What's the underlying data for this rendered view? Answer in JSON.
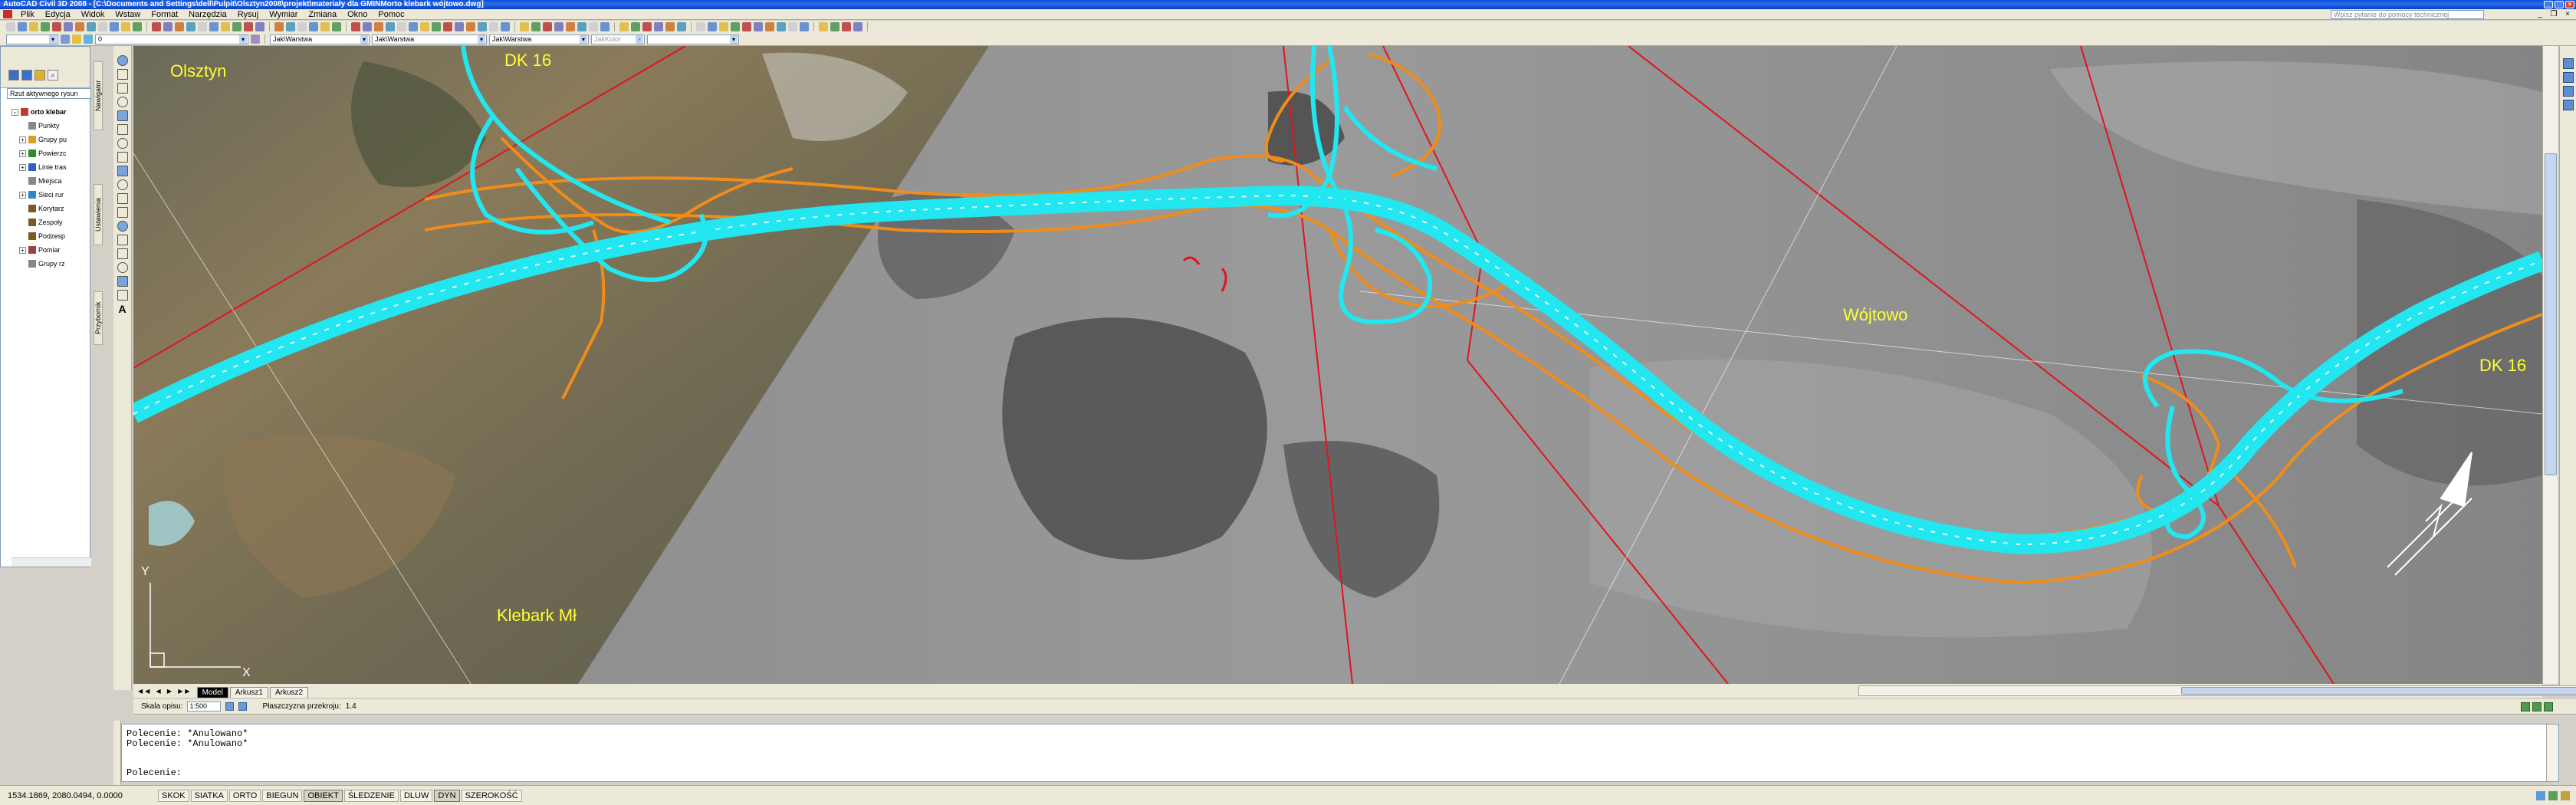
{
  "window": {
    "title": "AutoCAD Civil 3D 2008 - [C:\\Documents and Settings\\dell\\Pulpit\\Olsztyn2008\\projekt\\materiały dla GMINMorto klebark wójtowo.dwg]"
  },
  "menu": {
    "items": [
      "Plik",
      "Edycja",
      "Widok",
      "Wstaw",
      "Format",
      "Narzędzia",
      "Rysuj",
      "Wymiar",
      "Zmiana",
      "Okno",
      "Pomoc"
    ],
    "help_placeholder": "Wpisz pytanie do pomocy technicznej"
  },
  "toolbar": {
    "layer_combo": "Jak\\Warstwa",
    "linetype_combo": "Jak\\Warstwa",
    "lineweight_combo": "Jak\\Warstwa",
    "plotstyle_combo": "JakKolor",
    "layer_name": "0",
    "extra_combo": ""
  },
  "prospector": {
    "view_combo": "Rzut aktywnego rysun",
    "tree": [
      {
        "label": "orto klebar",
        "root": true,
        "expander": "-",
        "color": "#c0392b"
      },
      {
        "label": "Punkty",
        "expander": "",
        "color": "#888888"
      },
      {
        "label": "Grupy pu",
        "expander": "+",
        "color": "#d8a020"
      },
      {
        "label": "Powierzc",
        "expander": "+",
        "color": "#2e8b2e"
      },
      {
        "label": "Linie tras",
        "expander": "+",
        "color": "#3060c0"
      },
      {
        "label": "Miejsca",
        "expander": "",
        "color": "#888888"
      },
      {
        "label": "Sieci rur",
        "expander": "+",
        "color": "#2a88c8"
      },
      {
        "label": "Korytarz",
        "expander": "",
        "color": "#7a5a20"
      },
      {
        "label": "Zespoły",
        "expander": "",
        "color": "#7a5a20"
      },
      {
        "label": "Podzesp",
        "expander": "",
        "color": "#7a5a20"
      },
      {
        "label": "Pomiar",
        "expander": "+",
        "color": "#a04040"
      },
      {
        "label": "Grupy rz",
        "expander": "",
        "color": "#888888"
      }
    ]
  },
  "side_tabs": {
    "navigator": "Nawigator",
    "settings": "Ustawienia",
    "toolbox": "Przybornik"
  },
  "map": {
    "labels": {
      "olsztyn": "Olsztyn",
      "dk16_top": "DK 16",
      "dk16_right": "DK 16",
      "wojtowo": "Wójtowo",
      "klebark": "Klebark Mł"
    },
    "ucs": {
      "x": "X",
      "y": "Y"
    },
    "colors": {
      "road": "#22e6f0",
      "ramp": "#f08c1a",
      "boundary": "#e0141e",
      "label": "#ffff33"
    }
  },
  "layout_tabs": {
    "items": [
      "Model",
      "Arkusz1",
      "Arkusz2"
    ],
    "active": "Model"
  },
  "annotation": {
    "scale_label": "Skala opisu:",
    "scale_value": "1:500",
    "section_label": "Płaszczyzna przekroju:",
    "section_value": "1.4"
  },
  "command": {
    "lines": [
      "Polecenie: *Anulowano*",
      "Polecenie: *Anulowano*"
    ],
    "prompt": "Polecenie:"
  },
  "status": {
    "coords": "1534.1869, 2080.0494, 0.0000",
    "toggles": [
      {
        "label": "SKOK",
        "on": false
      },
      {
        "label": "SIATKA",
        "on": false
      },
      {
        "label": "ORTO",
        "on": false
      },
      {
        "label": "BIEGUN",
        "on": false
      },
      {
        "label": "OBIEKT",
        "on": true
      },
      {
        "label": "ŚLEDZENIE",
        "on": false
      },
      {
        "label": "DLUW",
        "on": false
      },
      {
        "label": "DYN",
        "on": true
      },
      {
        "label": "SZEROKOŚĆ",
        "on": false
      }
    ]
  }
}
